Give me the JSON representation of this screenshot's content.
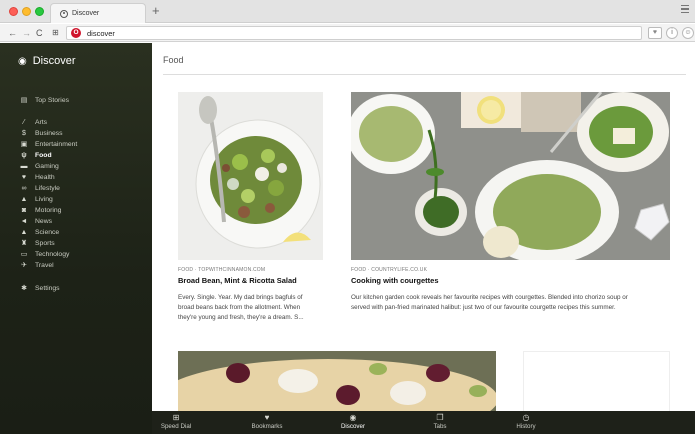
{
  "browser": {
    "tab_title": "Discover",
    "new_tab_symbol": "+",
    "address": "discover",
    "opera_badge": "O"
  },
  "sidebar": {
    "title": "Discover",
    "top_stories": "Top Stories",
    "categories": [
      {
        "label": "Arts",
        "icon": "brush-icon"
      },
      {
        "label": "Business",
        "icon": "dollar-icon"
      },
      {
        "label": "Entertainment",
        "icon": "film-icon"
      },
      {
        "label": "Food",
        "icon": "utensils-icon",
        "active": true
      },
      {
        "label": "Gaming",
        "icon": "gamepad-icon"
      },
      {
        "label": "Health",
        "icon": "heart-icon"
      },
      {
        "label": "Lifestyle",
        "icon": "glasses-icon"
      },
      {
        "label": "Living",
        "icon": "home-icon"
      },
      {
        "label": "Motoring",
        "icon": "car-icon"
      },
      {
        "label": "News",
        "icon": "megaphone-icon"
      },
      {
        "label": "Science",
        "icon": "flask-icon"
      },
      {
        "label": "Sports",
        "icon": "trophy-icon"
      },
      {
        "label": "Technology",
        "icon": "monitor-icon"
      },
      {
        "label": "Travel",
        "icon": "plane-icon"
      }
    ],
    "settings": "Settings"
  },
  "main": {
    "section_title": "Food",
    "articles": [
      {
        "source": "FOOD · TOPWITHCINNAMON.COM",
        "headline": "Broad Bean, Mint & Ricotta Salad",
        "desc_line1": "Every. Single. Year. My dad brings bagfuls of",
        "desc_line2": "broad beans back from the allotment. When",
        "desc_line3": "they're young and fresh, they're a dream. S..."
      },
      {
        "source": "FOOD · COUNTRYLIFE.CO.UK",
        "headline": "Cooking with courgettes",
        "desc_line1": "Our kitchen garden cook reveals her favourite recipes with courgettes. Blended into chorizo soup or",
        "desc_line2": "served with pan-fried marinated halibut: just two of our favourite courgette recipes this summer."
      }
    ]
  },
  "bottombar": {
    "items": [
      {
        "label": "Speed Dial",
        "icon": "grid-icon"
      },
      {
        "label": "Bookmarks",
        "icon": "heart-icon"
      },
      {
        "label": "Discover",
        "icon": "eye-icon",
        "active": true
      },
      {
        "label": "Tabs",
        "icon": "tabs-icon"
      },
      {
        "label": "History",
        "icon": "clock-icon"
      }
    ]
  },
  "colors": {
    "sidebar_bg": "#1d2217",
    "opera_red": "#d0142c",
    "bottombar_bg": "#1e2119"
  }
}
